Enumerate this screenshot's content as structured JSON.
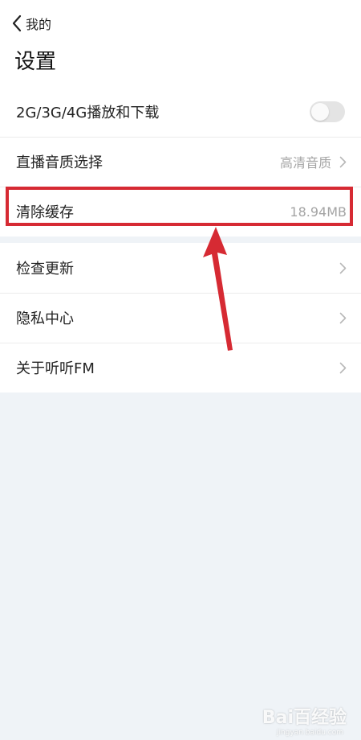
{
  "header": {
    "back_label": "我的",
    "title": "设置"
  },
  "settings": {
    "network_play_download": {
      "label": "2G/3G/4G播放和下载",
      "toggle_on": false
    },
    "live_quality": {
      "label": "直播音质选择",
      "value": "高清音质"
    },
    "clear_cache": {
      "label": "清除缓存",
      "value": "18.94MB"
    },
    "check_update": {
      "label": "检查更新"
    },
    "privacy_center": {
      "label": "隐私中心"
    },
    "about": {
      "label": "关于听听FM"
    }
  },
  "watermark": {
    "brand": "Bai百经验",
    "url": "jingyan.baidu.com"
  },
  "colors": {
    "highlight": "#d62a33",
    "background": "#eff3f7"
  }
}
